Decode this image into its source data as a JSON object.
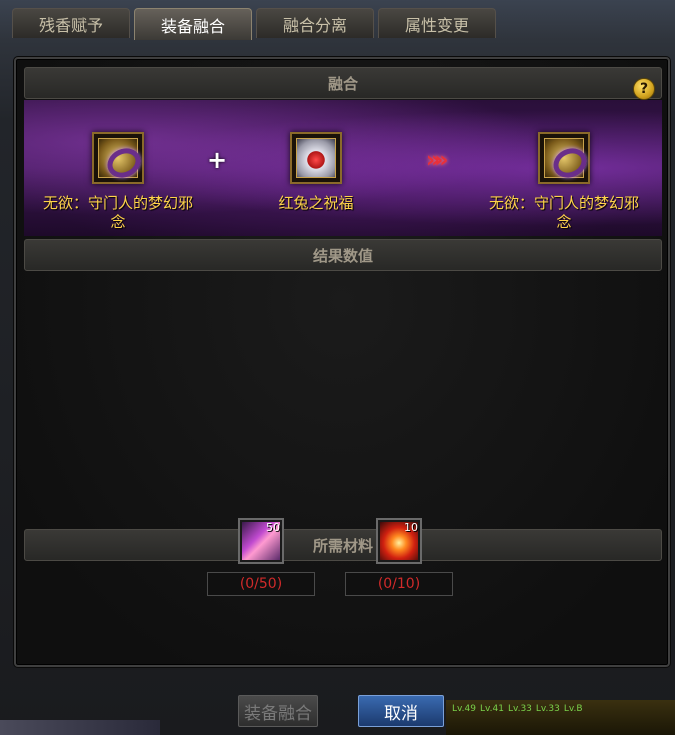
{
  "tabs": [
    {
      "label": "残香赋予",
      "active": false
    },
    {
      "label": "装备融合",
      "active": true
    },
    {
      "label": "融合分离",
      "active": false
    },
    {
      "label": "属性变更",
      "active": false
    }
  ],
  "fusion": {
    "section_title": "融合",
    "help_label": "?",
    "plus_symbol": "+",
    "arrow_symbol": "»»",
    "source_item": {
      "name": "无欲：守门人的梦幻邪念"
    },
    "catalyst_item": {
      "name": "红兔之祝福"
    },
    "result_item": {
      "name": "无欲：守门人的梦幻邪念"
    }
  },
  "result": {
    "section_title": "结果数值"
  },
  "materials": {
    "section_title": "所需材料",
    "items": [
      {
        "count_badge": "50",
        "requirement": "(0/50)"
      },
      {
        "count_badge": "10",
        "requirement": "(0/10)"
      }
    ]
  },
  "buttons": {
    "fuse": "装备融合",
    "cancel": "取消"
  },
  "bottom_strip": {
    "levels": [
      "Lv.49",
      "Lv.41",
      "Lv.33",
      "Lv.33",
      "Lv.B"
    ]
  },
  "colors": {
    "item_name": "#ffd34a",
    "requirement_text": "#d02a2a",
    "cancel_button": "#2a4f8f"
  }
}
